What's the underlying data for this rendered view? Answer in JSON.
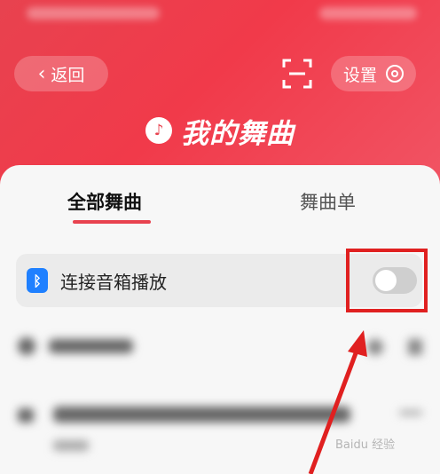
{
  "header": {
    "back_label": "返回",
    "settings_label": "设置",
    "title": "我的舞曲"
  },
  "tabs": [
    {
      "label": "全部舞曲",
      "active": true
    },
    {
      "label": "舞曲单",
      "active": false
    }
  ],
  "bluetooth": {
    "label": "连接音箱播放",
    "enabled": false
  },
  "colors": {
    "accent": "#e8424f",
    "bluetooth": "#1f80ff",
    "highlight": "#e02020"
  },
  "icons": [
    "chevron-left-icon",
    "scan-icon",
    "gear-icon",
    "music-note-icon",
    "bluetooth-icon"
  ]
}
